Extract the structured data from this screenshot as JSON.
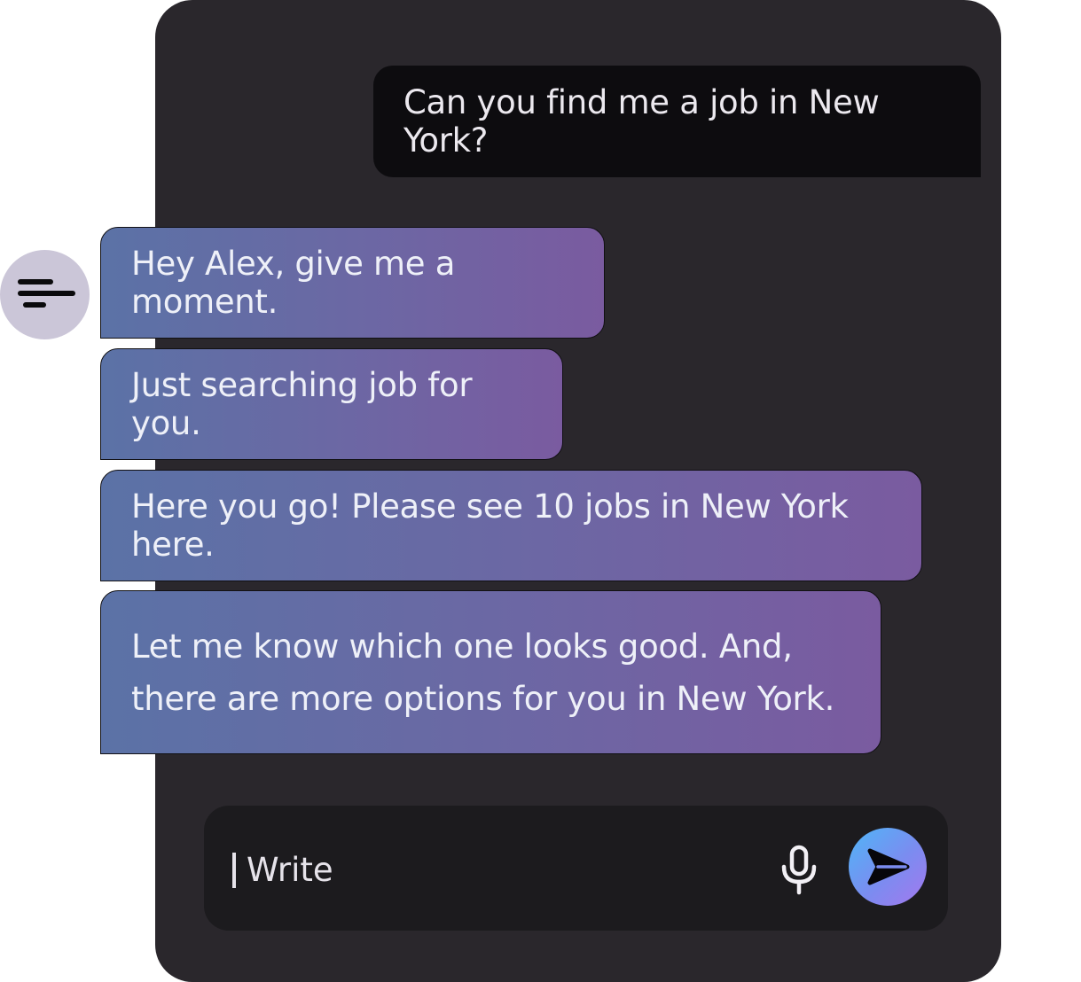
{
  "chat": {
    "user_message": "Can you find me a job in New York?",
    "bot_messages": [
      "Hey Alex, give me a moment.",
      "Just searching job for you.",
      "Here you go! Please see 10 jobs in New York here.",
      "Let me know which one looks good. And, there are more options for you in New York."
    ]
  },
  "composer": {
    "placeholder": "Write"
  },
  "icons": {
    "avatar": "assistant-lines-icon",
    "mic": "microphone-icon",
    "send": "send-arrow-icon"
  },
  "colors": {
    "panel_bg": "#2a272c",
    "user_bubble_bg": "#0d0c0f",
    "bot_gradient_start": "#5b72a6",
    "bot_gradient_end": "#7a5ba0",
    "avatar_bg": "#cbc6d8",
    "send_gradient_start": "#4fb6f7",
    "send_gradient_end": "#a478ee"
  }
}
